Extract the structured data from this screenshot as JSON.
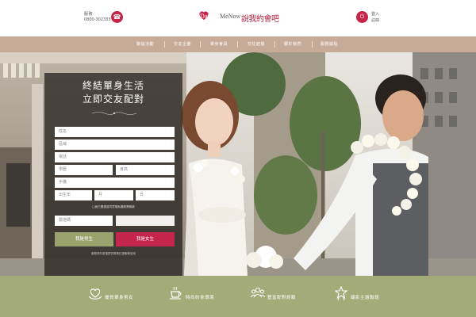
{
  "header": {
    "phone_label": "服務",
    "phone_number": "0800-302333",
    "logo_latin_1": "Date",
    "logo_latin_2": "MeNow",
    "logo_cjk": "說我約會吧",
    "login_label": "登入",
    "register_label": "註冊",
    "icons": [
      "phone-icon",
      "login-icon"
    ]
  },
  "nav": {
    "items": [
      "聯誼活動",
      "交友企劃",
      "單身會員",
      "交往結婚",
      "關於我們",
      "服務據點"
    ]
  },
  "form": {
    "title_line1": "終結單身生活",
    "title_line2": "立即交友配對",
    "fields": {
      "name": "姓名",
      "region": "區域",
      "phone": "電話",
      "education": "學歷",
      "height": "身高",
      "mobile": "手機",
      "birth_year": "出生年",
      "birth_month": "月",
      "birth_day": "日",
      "verify": "驗證碼"
    },
    "privacy_note": "□我已閱讀並同意隱私權政策條款",
    "male_button": "我是男生",
    "female_button": "我是女生",
    "footer_note": "服務資料將僅提供專業紅娘聯繫使用"
  },
  "features": [
    {
      "icon": "heart-hands-icon",
      "label": "優質單身男女"
    },
    {
      "icon": "coffee-cup-icon",
      "label": "時尚約會環境"
    },
    {
      "icon": "people-group-icon",
      "label": "豐富配對經驗"
    },
    {
      "icon": "star-badge-icon",
      "label": "顧影主題聯誼"
    }
  ],
  "colors": {
    "brand_red": "#c6264a",
    "nav_taupe": "#c8aa99",
    "olive_green": "#a3ab78",
    "male_button": "#9aa26e",
    "female_button": "#c5254b"
  }
}
